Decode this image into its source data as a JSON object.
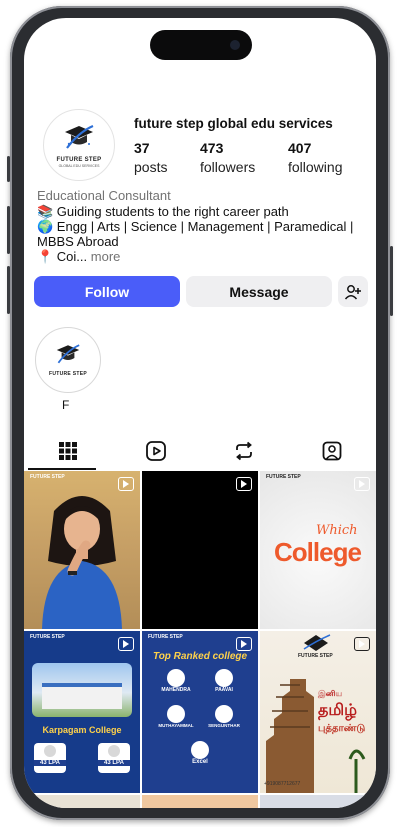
{
  "profile": {
    "username": "future step global edu services",
    "logo_text": "FUTURE STEP",
    "logo_sub": "GLOBAL EDU SERVICES",
    "stats": [
      {
        "value": "37",
        "label": "posts"
      },
      {
        "value": "473",
        "label": "followers"
      },
      {
        "value": "407",
        "label": "following"
      }
    ],
    "category": "Educational Consultant",
    "bio_lines": [
      "📚 Guiding students to the right career path",
      "🌍 Engg | Arts | Science | Management | Paramedical |",
      "MBBS Abroad",
      "📍 Coi..."
    ],
    "more_label": "more"
  },
  "actions": {
    "follow_label": "Follow",
    "message_label": "Message",
    "add_icon": "add-person-icon"
  },
  "highlights": [
    {
      "label": "F"
    }
  ],
  "tabs": [
    {
      "name": "grid",
      "icon": "grid-icon"
    },
    {
      "name": "reels",
      "icon": "reels-icon"
    },
    {
      "name": "reposts",
      "icon": "repost-icon"
    },
    {
      "name": "tagged",
      "icon": "tagged-icon"
    }
  ],
  "posts": {
    "college_which": "Which",
    "college_word": "College",
    "karpagam": "Karpagam College",
    "lpa_1": "43 LPA",
    "lpa_2": "43 LPA",
    "top_ranked": "Top Ranked college",
    "colleges": [
      "MAHENDRA",
      "PAAVAI",
      "MUTHAYAMMAL",
      "SENGUNTHAR",
      "Excel"
    ],
    "tamil_1": "இனிய",
    "tamil_2": "தமிழ்",
    "tamil_3": "புத்தாண்டு",
    "phone": "+919087712677"
  },
  "colors": {
    "follow_button": "#4a5df9",
    "secondary_button": "#efeff1",
    "college_orange": "#ee5a2c",
    "navy_post": "#1f3f8f"
  }
}
